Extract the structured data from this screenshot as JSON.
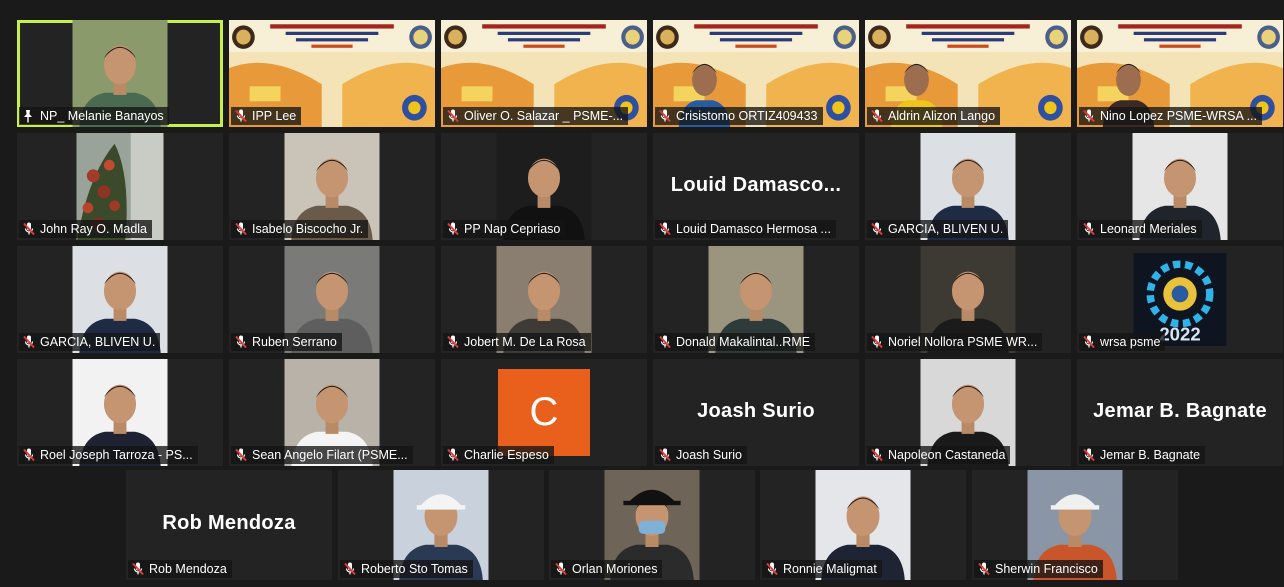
{
  "meeting": {
    "active_speaker_color": "#c8f04a",
    "muted_icon_color": "#e23b3b"
  },
  "participants": [
    {
      "name": "NP_ Melanie Banayos",
      "video": "person",
      "muted": false,
      "pinned": true,
      "active": true,
      "shirt": "#4a6b4f",
      "bg": "#8a9a6a"
    },
    {
      "name": "IPP Lee",
      "video": "poster",
      "muted": true,
      "poster_caption": "on: Sustaining Digital ds Industrial Excellence"
    },
    {
      "name": "Oliver O. Salazar _ PSME-...",
      "video": "poster",
      "muted": true
    },
    {
      "name": "Crisistomo ORTIZ409433",
      "video": "person-poster",
      "muted": true,
      "shirt": "#2a5aa0"
    },
    {
      "name": "Aldrin Alizon Lango",
      "video": "person-poster",
      "muted": true,
      "shirt": "#f0c419"
    },
    {
      "name": "Nino Lopez PSME-WRSA ...",
      "video": "person-poster",
      "muted": true,
      "shirt": "#3b2a24"
    },
    {
      "name": "John Ray O. Madla",
      "video": "plant",
      "muted": true
    },
    {
      "name": "Isabelo Biscocho Jr.",
      "video": "person",
      "muted": true,
      "shirt": "#6a5a4a",
      "bg": "#c9c3b8"
    },
    {
      "name": "PP Nap Cepriaso",
      "video": "person",
      "muted": true,
      "shirt": "#111111",
      "bg": "#1d1d1d"
    },
    {
      "name": "Louid Damasco Hermosa ...",
      "video": "text",
      "display_text": "Louid Damasco...",
      "muted": true
    },
    {
      "name": "GARCIA, BLIVEN U.",
      "video": "person",
      "muted": true,
      "shirt": "#1f2a44",
      "bg": "#dcdfe4"
    },
    {
      "name": "Leonard Meriales",
      "video": "person",
      "muted": true,
      "shirt": "#20242c",
      "bg": "#e6e6e6"
    },
    {
      "name": "GARCIA, BLIVEN U.",
      "video": "person",
      "muted": true,
      "shirt": "#1f2a44",
      "bg": "#dcdfe4"
    },
    {
      "name": "Ruben Serrano",
      "video": "person",
      "muted": true,
      "shirt": "#5e5e5e",
      "bg": "#7a7a78"
    },
    {
      "name": "Jobert M. De La Rosa",
      "video": "person",
      "muted": true,
      "shirt": "#3e3a36",
      "bg": "#8a7e70"
    },
    {
      "name": "Donald Makalintal..RME",
      "video": "person",
      "muted": true,
      "shirt": "#2f3a3a",
      "bg": "#9b9580"
    },
    {
      "name": "Noriel Nollora PSME WR...",
      "video": "person",
      "muted": true,
      "shirt": "#1b1b1b",
      "bg": "#3d3a33"
    },
    {
      "name": "wrsa psme",
      "video": "logo",
      "logo_text": "2022",
      "muted": true
    },
    {
      "name": "Roel Joseph Tarroza - PS...",
      "video": "person",
      "muted": true,
      "shirt": "#1e2233",
      "bg": "#f2f2f2"
    },
    {
      "name": "Sean Angelo Filart (PSME...",
      "video": "person",
      "muted": true,
      "shirt": "#f4f4f4",
      "bg": "#b8b2a8"
    },
    {
      "name": "Charlie Espeso",
      "video": "avatar",
      "avatar_letter": "C",
      "muted": true
    },
    {
      "name": "Joash Surio",
      "video": "text",
      "display_text": "Joash Surio",
      "muted": true
    },
    {
      "name": "Napoleon Castaneda",
      "video": "person",
      "muted": true,
      "shirt": "#1a1a1a",
      "bg": "#d8d8d8"
    },
    {
      "name": "Jemar B. Bagnate",
      "video": "text",
      "display_text": "Jemar B. Bagnate",
      "muted": true
    },
    {
      "name": "Rob Mendoza",
      "video": "text",
      "display_text": "Rob Mendoza",
      "muted": true
    },
    {
      "name": "Roberto Sto Tomas",
      "video": "person",
      "muted": true,
      "shirt": "#2a3a55",
      "bg": "#c9d2dc",
      "helmet": "#f4f4f4"
    },
    {
      "name": "Orlan Moriones",
      "video": "person",
      "muted": true,
      "shirt": "#2b2b2b",
      "bg": "#6f6458",
      "mask": true
    },
    {
      "name": "Ronnie Maligmat",
      "video": "person",
      "muted": true,
      "shirt": "#1e2433",
      "bg": "#e4e6ea"
    },
    {
      "name": "Sherwin Francisco",
      "video": "person",
      "muted": true,
      "shirt": "#c9552a",
      "bg": "#8a96a6",
      "helmet": "#f0f0f0"
    }
  ]
}
